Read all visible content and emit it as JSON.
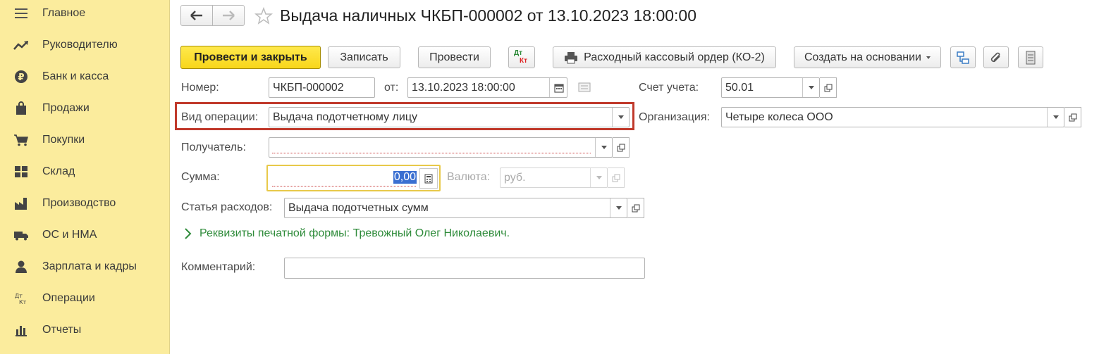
{
  "sidebar": {
    "items": [
      {
        "label": "Главное",
        "icon": "menu-lines-icon"
      },
      {
        "label": "Руководителю",
        "icon": "trend-up-icon"
      },
      {
        "label": "Банк и касса",
        "icon": "ruble-coin-icon"
      },
      {
        "label": "Продажи",
        "icon": "shopping-bag-icon"
      },
      {
        "label": "Покупки",
        "icon": "shopping-cart-icon"
      },
      {
        "label": "Склад",
        "icon": "warehouse-grid-icon"
      },
      {
        "label": "Производство",
        "icon": "factory-icon"
      },
      {
        "label": "ОС и НМА",
        "icon": "truck-icon"
      },
      {
        "label": "Зарплата и кадры",
        "icon": "person-icon"
      },
      {
        "label": "Операции",
        "icon": "dt-kt-icon"
      },
      {
        "label": "Отчеты",
        "icon": "bar-chart-icon"
      }
    ]
  },
  "header": {
    "title": "Выдача наличных ЧКБП-000002 от 13.10.2023 18:00:00"
  },
  "toolbar": {
    "post_close_label": "Провести и закрыть",
    "save_label": "Записать",
    "post_label": "Провести",
    "dtkt_top": "Дт",
    "dtkt_bottom": "Кт",
    "print_label": "Расходный кассовый ордер (КО-2)",
    "create_based_label": "Создать на основании"
  },
  "form": {
    "number_label": "Номер:",
    "number_value": "ЧКБП-000002",
    "from_label": "от:",
    "date_value": "13.10.2023 18:00:00",
    "account_label": "Счет учета:",
    "account_value": "50.01",
    "operation_label": "Вид операции:",
    "operation_value": "Выдача подотчетному лицу",
    "org_label": "Организация:",
    "org_value": "Четыре колеса ООО",
    "recipient_label": "Получатель:",
    "recipient_value": "",
    "sum_label": "Сумма:",
    "sum_value": "0,00",
    "currency_label": "Валюта:",
    "currency_value": "руб.",
    "expense_label": "Статья расходов:",
    "expense_value": "Выдача подотчетных сумм",
    "print_details_link": "Реквизиты печатной формы: Тревожный Олег Николаевич.",
    "comment_label": "Комментарий:",
    "comment_value": ""
  },
  "colors": {
    "sidebar_bg": "#fbec9d",
    "primary_button": "#f8d61a",
    "highlight_border": "#c0392b",
    "link_green": "#2e8b3a",
    "active_field_border": "#e8c94a"
  }
}
